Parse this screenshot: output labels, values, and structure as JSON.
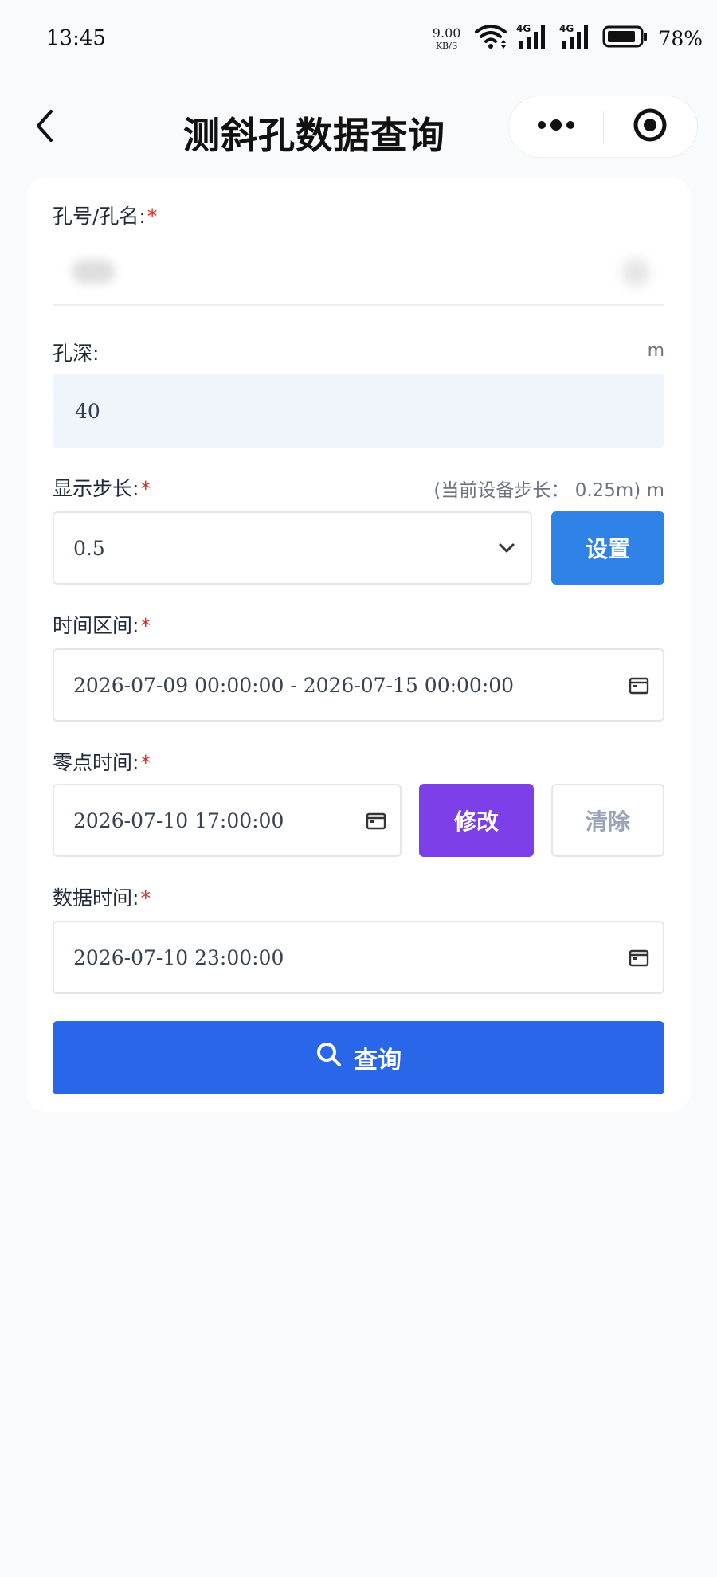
{
  "status_bar": {
    "time": "13:45",
    "net_speed_value": "9.00",
    "net_speed_unit": "KB/S",
    "network_type_1": "4G",
    "network_type_2": "4G",
    "battery_percent": "78%"
  },
  "nav": {
    "title": "测斜孔数据查询",
    "back_icon": "chevron-left-icon",
    "more_icon": "more-dots-icon",
    "close_icon": "target-circle-icon"
  },
  "form": {
    "hole": {
      "label": "孔号/孔名:",
      "required_mark": "*"
    },
    "depth": {
      "label": "孔深:",
      "unit": "m",
      "value": "40"
    },
    "step": {
      "label": "显示步长:",
      "required_mark": "*",
      "hint": "(当前设备步长： 0.25m) m",
      "selected": "0.5",
      "set_button": "设置"
    },
    "time_range": {
      "label": "时间区间:",
      "required_mark": "*",
      "value": "2026-07-09 00:00:00 - 2026-07-15 00:00:00"
    },
    "zero_time": {
      "label": "零点时间:",
      "required_mark": "*",
      "value": "2026-07-10 17:00:00",
      "modify_button": "修改",
      "clear_button": "清除"
    },
    "data_time": {
      "label": "数据时间:",
      "required_mark": "*",
      "value": "2026-07-10 23:00:00"
    },
    "query_button": "查询"
  },
  "colors": {
    "set_button": "#2f83e6",
    "modify_button": "#7c3fe8",
    "query_button": "#2a66e8",
    "required": "#dc2626"
  }
}
